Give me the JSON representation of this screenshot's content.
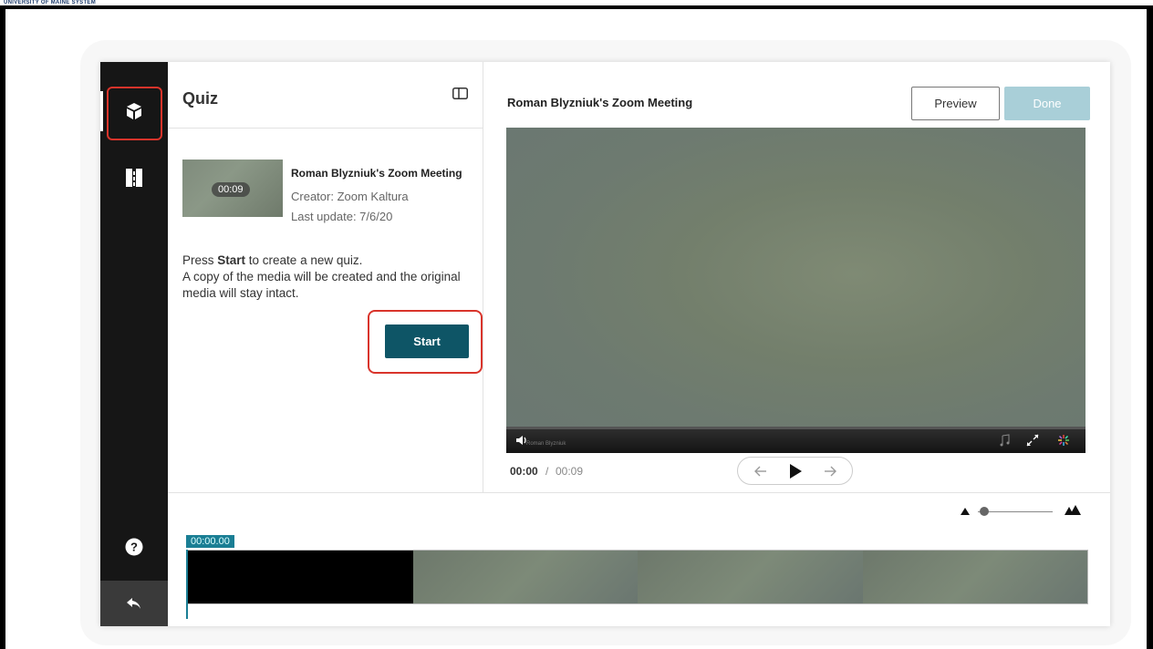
{
  "header": {
    "brand": "UNIVERSITY OF MAINE SYSTEM"
  },
  "sidebar": {
    "items": [
      {
        "name": "quiz",
        "icon": "cube-icon"
      },
      {
        "name": "chapters",
        "icon": "chapters-icon"
      },
      {
        "name": "help",
        "icon": "help-icon"
      },
      {
        "name": "back",
        "icon": "back-arrow-icon"
      }
    ]
  },
  "left_panel": {
    "title": "Quiz",
    "media": {
      "name": "Roman Blyzniuk's Zoom Meeting",
      "creator": "Creator: Zoom Kaltura",
      "last_update": "Last update: 7/6/20",
      "duration_badge": "00:09"
    },
    "instructions": {
      "line1_prefix": "Press ",
      "line1_bold": "Start",
      "line1_suffix": " to create a new quiz.",
      "line2": "A copy of the media will be created and the original media will stay intact."
    },
    "start_label": "Start"
  },
  "player": {
    "title": "Roman Blyzniuk's Zoom Meeting",
    "preview_label": "Preview",
    "done_label": "Done",
    "current_time": "00:00",
    "separator": "/",
    "duration": "00:09",
    "watermark": "Roman Blyzniuk"
  },
  "timeline": {
    "playhead_label": "00:00.00",
    "zoom_level": 0.1
  },
  "colors": {
    "accent": "#0e5566",
    "timeline_accent": "#1a7e94",
    "highlight": "#d9342b",
    "done_disabled": "#a9cfd8"
  }
}
